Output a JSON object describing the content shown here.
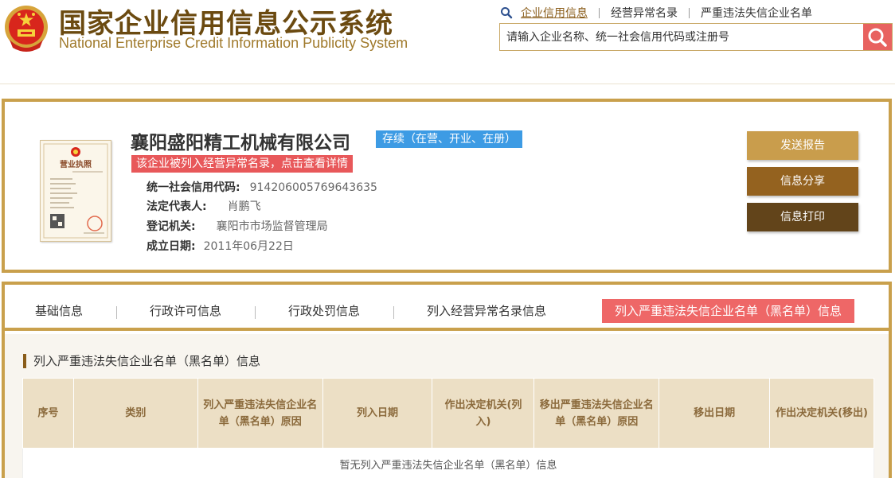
{
  "header": {
    "title_cn": "国家企业信用信息公示系统",
    "title_en": "National Enterprise Credit Information Publicity System",
    "nav": [
      {
        "label": "企业信用信息"
      },
      {
        "label": "经营异常名录"
      },
      {
        "label": "严重违法失信企业名单"
      }
    ],
    "search_placeholder": "请输入企业名称、统一社会信用代码或注册号"
  },
  "company": {
    "name": "襄阳盛阳精工机械有限公司",
    "status": "存续（在营、开业、在册）",
    "abnormal_notice": "该企业被列入经营异常名录，点击查看详情",
    "fields": [
      {
        "label": "统一社会信用代码:",
        "value": "914206005769643635"
      },
      {
        "label": "法定代表人:",
        "value": "肖鹏飞"
      },
      {
        "label": "登记机关:",
        "value": "襄阳市市场监督管理局"
      },
      {
        "label": "成立日期:",
        "value": "2011年06月22日"
      }
    ],
    "license_title": "营业执照"
  },
  "actions": [
    {
      "label": "发送报告",
      "color": "#c99d4c"
    },
    {
      "label": "信息分享",
      "color": "#94621f"
    },
    {
      "label": "信息打印",
      "color": "#62441a"
    }
  ],
  "tabs": [
    {
      "label": "基础信息"
    },
    {
      "label": "行政许可信息"
    },
    {
      "label": "行政处罚信息"
    },
    {
      "label": "列入经营异常名录信息"
    },
    {
      "label": "列入严重违法失信企业名单（黑名单）信息"
    }
  ],
  "section": {
    "title": "列入严重违法失信企业名单（黑名单）信息",
    "columns": [
      "序号",
      "类别",
      "列入严重违法失信企业名单（黑名单）原因",
      "列入日期",
      "作出决定机关(列入)",
      "移出严重违法失信企业名单（黑名单）原因",
      "移出日期",
      "作出决定机关(移出)"
    ],
    "empty_text": "暂无列入严重违法失信企业名单（黑名单）信息"
  },
  "colors": {
    "brand_gold": "#c9a04c",
    "brand_brown": "#6b4a10",
    "active_tab": "#ee6767",
    "status_blue": "#3d9be4",
    "alert_red": "#e8585a"
  }
}
